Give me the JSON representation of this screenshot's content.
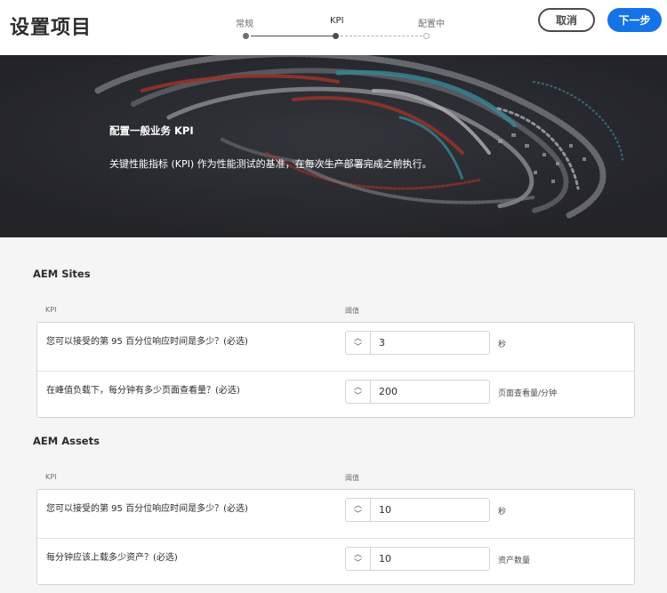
{
  "header": {
    "title": "设置项目",
    "steps": [
      {
        "label": "常规",
        "state": "done"
      },
      {
        "label": "KPI",
        "state": "current"
      },
      {
        "label": "配置中",
        "state": "future"
      }
    ],
    "cancel_label": "取消",
    "next_label": "下一步"
  },
  "hero": {
    "title": "配置一般业务 KPI",
    "description": "关键性能指标 (KPI) 作为性能测试的基准，在每次生产部署完成之前执行。"
  },
  "sections": [
    {
      "title": "AEM Sites",
      "col_kpi": "KPI",
      "col_threshold": "阈值",
      "rows": [
        {
          "question": "您可以接受的第 95 百分位响应时间是多少？(必选)",
          "value": "3",
          "unit": "秒"
        },
        {
          "question": "在峰值负载下，每分钟有多少页面查看量？(必选)",
          "value": "200",
          "unit": "页面查看量/分钟"
        }
      ]
    },
    {
      "title": "AEM Assets",
      "col_kpi": "KPI",
      "col_threshold": "阈值",
      "rows": [
        {
          "question": "您可以接受的第 95 百分位响应时间是多少？(必选)",
          "value": "10",
          "unit": "秒"
        },
        {
          "question": "每分钟应该上载多少资产？(必选)",
          "value": "10",
          "unit": "资产数量"
        }
      ]
    }
  ],
  "colors": {
    "accent": "#1473e6",
    "hero_bg": "#2a2b31"
  }
}
